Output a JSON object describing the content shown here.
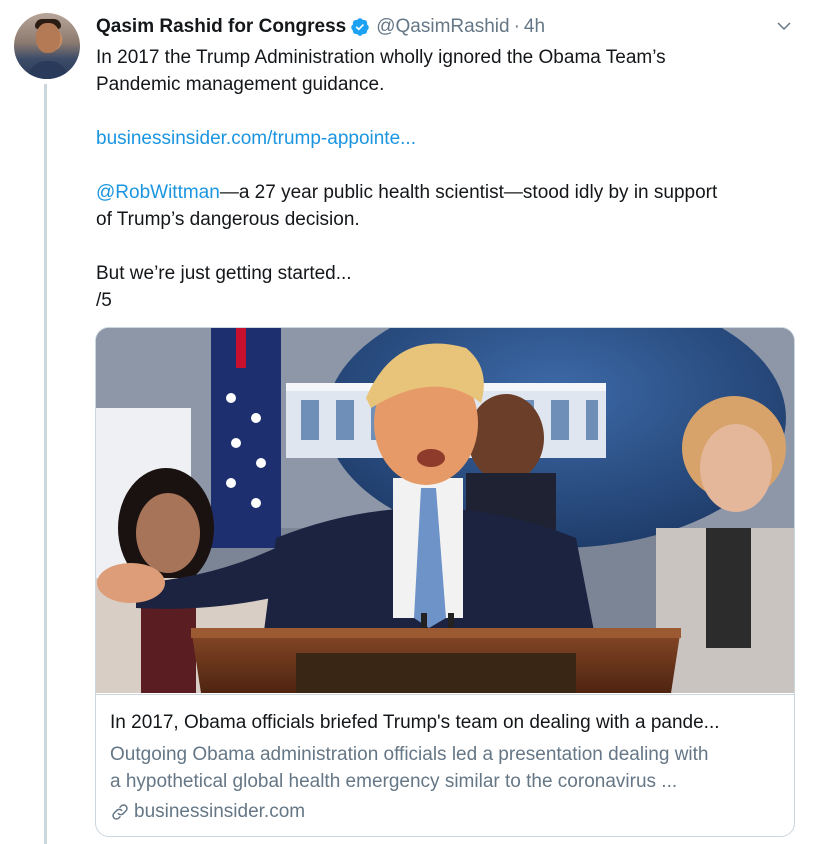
{
  "tweet": {
    "author_name": "Qasim Rashid for Congress",
    "handle": "@QasimRashid",
    "separator": "·",
    "timestamp": "4h",
    "verified_icon": "verified-badge-icon",
    "more_icon": "chevron-down-icon",
    "lines": {
      "p1": "In 2017 the Trump Administration wholly ignored the Obama Team’s",
      "p2": "Pandemic management guidance.",
      "link": "businessinsider.com/trump-appointe...",
      "mention": "@RobWittman",
      "p3a": "—a 27 year public health scientist—stood idly by in support",
      "p3b": "of Trump’s dangerous decision.",
      "p4": "But we’re just getting started...",
      "p5": "/5"
    }
  },
  "card": {
    "image_alt": "Photo of Trump speaking at White House press briefing podium",
    "title": "In 2017, Obama officials briefed Trump's team on dealing with a pande...",
    "description_line1": "Outgoing Obama administration officials led a presentation dealing with",
    "description_line2": "a hypothetical global health emergency similar to the coronavirus ...",
    "domain": "businessinsider.com",
    "domain_icon": "link-icon"
  },
  "colors": {
    "link": "#1b95e0",
    "secondary_text": "#657786",
    "border": "#ccd6dd",
    "verified": "#1da1f2"
  }
}
